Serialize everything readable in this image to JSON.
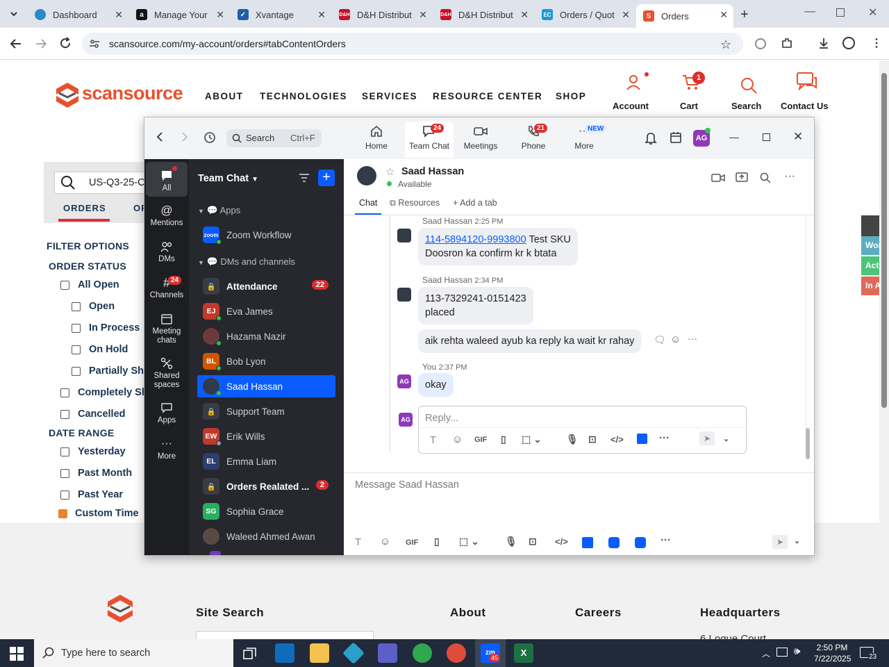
{
  "browser": {
    "tabs": [
      {
        "label": "Dashboard",
        "color": "#2a8ac6"
      },
      {
        "label": "Manage Your",
        "color": "#111111"
      },
      {
        "label": "Xvantage",
        "color": "#1f5da8"
      },
      {
        "label": "D&H Distribut",
        "color": "#c8102e"
      },
      {
        "label": "D&H Distribut",
        "color": "#c8102e"
      },
      {
        "label": "Orders / Quot",
        "color": "#1a9bd7"
      },
      {
        "label": "Orders",
        "color": "#e8502d"
      }
    ],
    "url": "scansource.com/my-account/orders#tabContentOrders"
  },
  "site": {
    "logo": "scansource",
    "nav": [
      "ABOUT",
      "TECHNOLOGIES",
      "SERVICES",
      "RESOURCE CENTER",
      "SHOP"
    ],
    "header_actions": {
      "account": "Account",
      "cart": "Cart",
      "cart_count": "1",
      "search": "Search",
      "contact": "Contact Us"
    },
    "search_value": "US-Q3-25-C",
    "tab_orders": "ORDERS",
    "tab_other": "OR",
    "filter_options": "FILTER OPTIONS",
    "order_status": "ORDER STATUS",
    "status_items": [
      "All Open",
      "Open",
      "In Process",
      "On Hold",
      "Partially Sh",
      "Completely Sh",
      "Cancelled"
    ],
    "date_range": "DATE RANGE",
    "date_items": [
      "Yesterday",
      "Past Month",
      "Past Year"
    ],
    "custom_time": "Custom Time",
    "footer": {
      "site_search": "Site Search",
      "about": "About",
      "careers": "Careers",
      "headquarters": "Headquarters",
      "hq_line": "6 Logue Court"
    },
    "right_tabs": [
      "Worki",
      "Active",
      "In Act"
    ]
  },
  "zoom": {
    "search": {
      "placeholder": "Search",
      "shortcut": "Ctrl+F"
    },
    "nav": {
      "home": "Home",
      "team_chat": "Team Chat",
      "team_chat_badge": "24",
      "meetings": "Meetings",
      "phone": "Phone",
      "phone_badge": "21",
      "more": "More",
      "new_badge": "NEW"
    },
    "user_initials": "AG",
    "rail": {
      "all": "All",
      "mentions": "Mentions",
      "dms": "DMs",
      "channels": "Channels",
      "channels_badge": "24",
      "meeting_chats": "Meeting chats",
      "shared_spaces": "Shared spaces",
      "apps": "Apps",
      "more": "More"
    },
    "list": {
      "title": "Team Chat",
      "apps_header": "Apps",
      "zoom_workflow": "Zoom Workflow",
      "dms_header": "DMs and channels",
      "rows": [
        {
          "label": "Attendance",
          "type": "lock",
          "badge": "22",
          "bold": true
        },
        {
          "label": "Eva James",
          "initials": "EJ",
          "color": "#c0392b"
        },
        {
          "label": "Hazama Nazir",
          "initials": "",
          "color": "#6b3a3f"
        },
        {
          "label": "Bob Lyon",
          "initials": "BL",
          "color": "#d35400"
        },
        {
          "label": "Saad Hassan",
          "initials": "",
          "color": "#333a48",
          "selected": true
        },
        {
          "label": "Support Team",
          "type": "lock"
        },
        {
          "label": "Erik Wills",
          "initials": "EW",
          "color": "#c0392b"
        },
        {
          "label": "Emma Liam",
          "initials": "EL",
          "color": "#2c3e6b"
        },
        {
          "label": "Orders Realated ...",
          "type": "lock",
          "badge": "2",
          "bold": true
        },
        {
          "label": "Sophia Grace",
          "initials": "SG",
          "color": "#27ae60"
        },
        {
          "label": "Waleed Ahmed Awan",
          "initials": "",
          "color": "#5a4a42"
        }
      ]
    },
    "chat": {
      "name": "Saad Hassan",
      "status": "Available",
      "tabs": {
        "chat": "Chat",
        "resources": "Resources",
        "add_tab": "Add a tab"
      },
      "messages": [
        {
          "sender": "Saad Hassan",
          "time": "2:25 PM",
          "link": "114-5894120-9993800",
          "text_after": " Test SKU",
          "line2": "Doosron ka confirm kr k btata"
        },
        {
          "sender": "Saad Hassan",
          "time": "2:34 PM",
          "line1": "113-7329241-0151423",
          "line2": "placed"
        },
        {
          "text": "aik rehta waleed ayub ka reply ka wait kr rahay"
        },
        {
          "sender": "You",
          "time": "2:37 PM",
          "text": "okay"
        }
      ],
      "reply_placeholder": "Reply...",
      "message_placeholder": "Message Saad Hassan",
      "gif": "GIF"
    }
  },
  "taskbar": {
    "search_placeholder": "Type here to search",
    "time": "2:50 PM",
    "date": "7/22/2025",
    "notif_count": "23",
    "zoom_badge": "45"
  }
}
